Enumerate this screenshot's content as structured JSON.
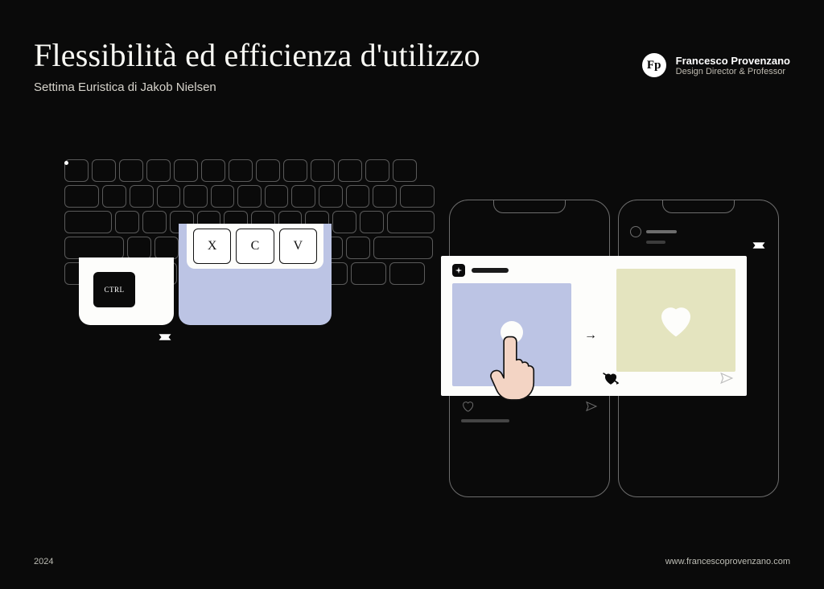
{
  "header": {
    "title": "Flessibilità ed efficienza d'utilizzo",
    "subtitle": "Settima Euristica di Jakob Nielsen"
  },
  "author": {
    "logo_initials": "Fp",
    "name": "Francesco Provenzano",
    "role": "Design Director & Professor"
  },
  "keyboard_callout": {
    "ctrl_label": "CTRL",
    "xcv_keys": [
      "X",
      "C",
      "V"
    ]
  },
  "gesture_arrow": "→",
  "footer": {
    "year": "2024",
    "url": "www.francescoprovenzano.com"
  },
  "colors": {
    "bg": "#0a0a0a",
    "cream": "#fdfdfb",
    "periwinkle": "#bcc4e4",
    "olive": "#e4e4bf"
  }
}
